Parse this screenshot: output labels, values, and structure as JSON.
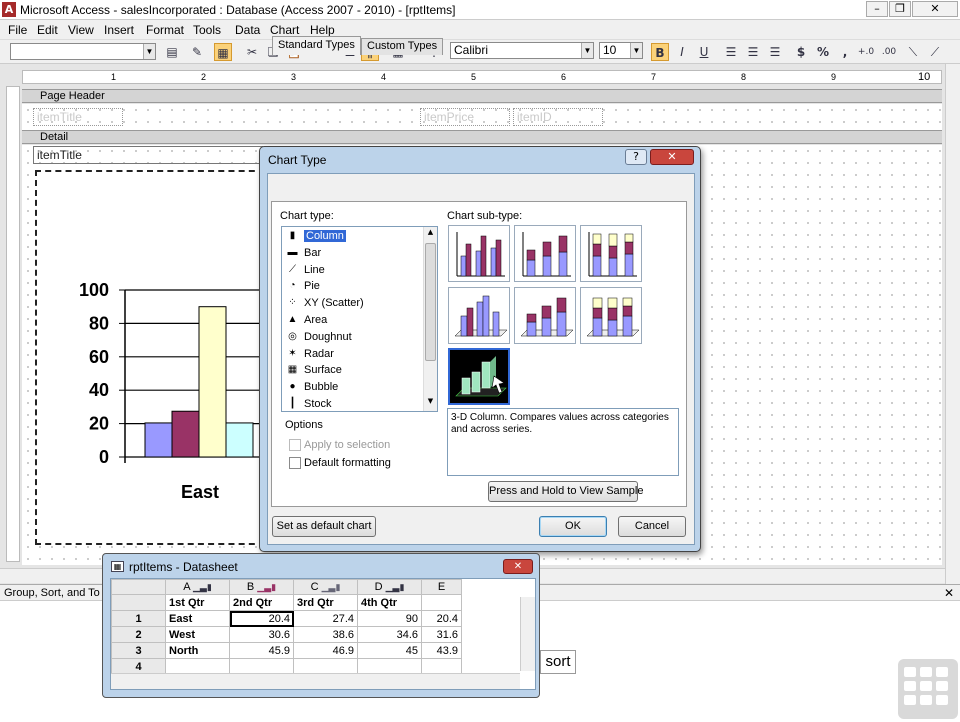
{
  "window": {
    "title": "Microsoft Access - salesIncorporated : Database (Access 2007 - 2010) - [rptItems]",
    "app_icon_letter": "A"
  },
  "menu": [
    "File",
    "Edit",
    "View",
    "Insert",
    "Format",
    "Tools",
    "Data",
    "Chart",
    "Help"
  ],
  "toolbar": {
    "object_combo": "",
    "font": "Calibri",
    "size": "10",
    "currency": "$",
    "percent": "%",
    "comma": ","
  },
  "ruler": [
    "1",
    "2",
    "3",
    "4",
    "5",
    "6",
    "7",
    "8",
    "9",
    "10"
  ],
  "report": {
    "page_header_label": "Page Header",
    "detail_label": "Detail",
    "header_fields": [
      "itemTitle",
      "itemPrice",
      "itemID"
    ],
    "detail_field": "itemTitle"
  },
  "chart_data": {
    "type": "bar",
    "categories": [
      "East"
    ],
    "series": [
      {
        "values": [
          20.4
        ],
        "color": "#9999ff"
      },
      {
        "values": [
          27.4
        ],
        "color": "#993366"
      },
      {
        "values": [
          90
        ],
        "color": "#ffffcc"
      },
      {
        "values": [
          20.4
        ],
        "color": "#ccffff"
      }
    ],
    "ylim": [
      0,
      100
    ],
    "yticks": [
      "100",
      "80",
      "60",
      "40",
      "20",
      "0"
    ],
    "grid": true
  },
  "dialog": {
    "title": "Chart Type",
    "tabs": [
      "Standard Types",
      "Custom Types"
    ],
    "chart_type_label": "Chart type:",
    "chart_types": [
      {
        "label": "Column",
        "icon": "column-chart-icon",
        "glyph": "▮"
      },
      {
        "label": "Bar",
        "icon": "bar-chart-icon",
        "glyph": "▬"
      },
      {
        "label": "Line",
        "icon": "line-chart-icon",
        "glyph": "⟋"
      },
      {
        "label": "Pie",
        "icon": "pie-chart-icon",
        "glyph": "◔"
      },
      {
        "label": "XY (Scatter)",
        "icon": "scatter-chart-icon",
        "glyph": "⁘"
      },
      {
        "label": "Area",
        "icon": "area-chart-icon",
        "glyph": "▲"
      },
      {
        "label": "Doughnut",
        "icon": "doughnut-chart-icon",
        "glyph": "◎"
      },
      {
        "label": "Radar",
        "icon": "radar-chart-icon",
        "glyph": "✶"
      },
      {
        "label": "Surface",
        "icon": "surface-chart-icon",
        "glyph": "▦"
      },
      {
        "label": "Bubble",
        "icon": "bubble-chart-icon",
        "glyph": "●"
      },
      {
        "label": "Stock",
        "icon": "stock-chart-icon",
        "glyph": "┃"
      }
    ],
    "selected_type": "Column",
    "subtype_label": "Chart sub-type:",
    "options_label": "Options",
    "apply_to_selection": "Apply to selection",
    "default_formatting": "Default formatting",
    "description": "3-D Column. Compares values across categories and across series.",
    "press_hold": "Press and Hold to View Sample",
    "set_default": "Set as default chart",
    "ok": "OK",
    "cancel": "Cancel",
    "help": "?"
  },
  "datasheet": {
    "title": "rptItems - Datasheet",
    "columns": [
      "A",
      "B",
      "C",
      "D",
      "E"
    ],
    "headers": [
      "1st Qtr",
      "2nd Qtr",
      "3rd Qtr",
      "4th Qtr"
    ],
    "rows": [
      {
        "num": "1",
        "name": "East",
        "values": [
          "20.4",
          "27.4",
          "90",
          "20.4"
        ]
      },
      {
        "num": "2",
        "name": "West",
        "values": [
          "30.6",
          "38.6",
          "34.6",
          "31.6"
        ]
      },
      {
        "num": "3",
        "name": "North",
        "values": [
          "45.9",
          "46.9",
          "45",
          "43.9"
        ]
      },
      {
        "num": "4",
        "name": "",
        "values": [
          "",
          "",
          "",
          ""
        ]
      }
    ]
  },
  "group_sort": {
    "label": "Group, Sort, and To",
    "sort_button": "sort"
  }
}
